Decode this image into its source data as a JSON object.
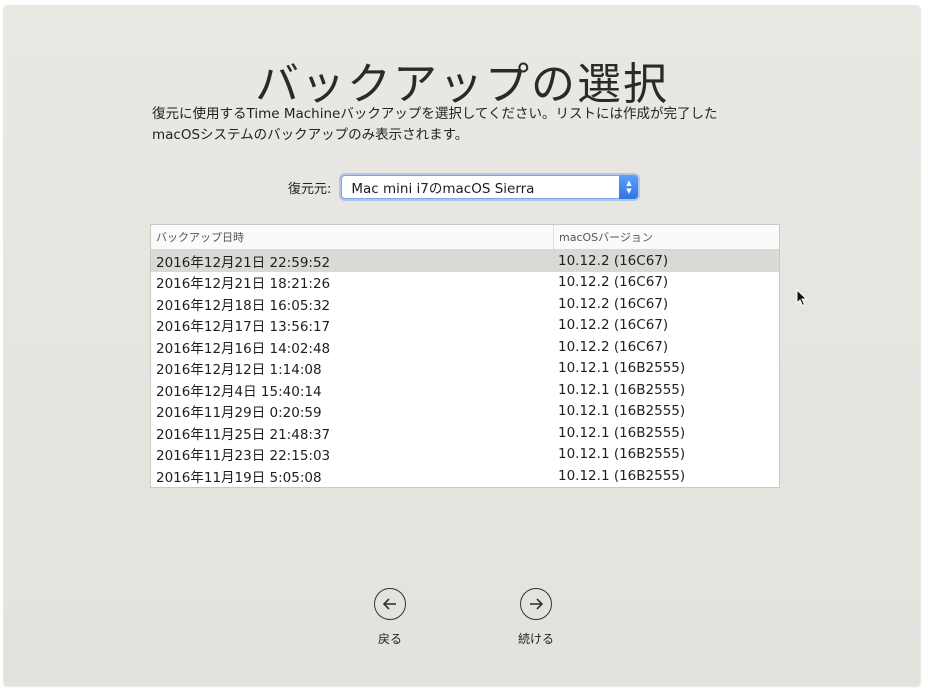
{
  "title": "バックアップの選択",
  "description": {
    "line1": "復元に使用するTime Machineバックアップを選択してください。リストには作成が完了した",
    "line2": "macOSシステムのバックアップのみ表示されます。"
  },
  "source": {
    "label": "復元元:",
    "selected": "Mac mini i7のmacOS Sierra"
  },
  "list": {
    "headers": {
      "date": "バックアップ日時",
      "version": "macOSバージョン"
    },
    "rows": [
      {
        "date": "2016年12月21日 22:59:52",
        "version": "10.12.2 (16C67)"
      },
      {
        "date": "2016年12月21日 18:21:26",
        "version": "10.12.2 (16C67)"
      },
      {
        "date": "2016年12月18日 16:05:32",
        "version": "10.12.2 (16C67)"
      },
      {
        "date": "2016年12月17日 13:56:17",
        "version": "10.12.2 (16C67)"
      },
      {
        "date": "2016年12月16日 14:02:48",
        "version": "10.12.2 (16C67)"
      },
      {
        "date": "2016年12月12日 1:14:08",
        "version": "10.12.1 (16B2555)"
      },
      {
        "date": "2016年12月4日 15:40:14",
        "version": "10.12.1 (16B2555)"
      },
      {
        "date": "2016年11月29日 0:20:59",
        "version": "10.12.1 (16B2555)"
      },
      {
        "date": "2016年11月25日 21:48:37",
        "version": "10.12.1 (16B2555)"
      },
      {
        "date": "2016年11月23日 22:15:03",
        "version": "10.12.1 (16B2555)"
      },
      {
        "date": "2016年11月19日 5:05:08",
        "version": "10.12.1 (16B2555)"
      }
    ]
  },
  "nav": {
    "back_label": "戻る",
    "back_icon": "arrow-left-circle-icon",
    "continue_label": "続ける",
    "continue_icon": "arrow-right-circle-icon"
  },
  "colors": {
    "background": "#e6e5e0",
    "selection": "#d9d9d6",
    "accent": "#3a7ee8"
  }
}
